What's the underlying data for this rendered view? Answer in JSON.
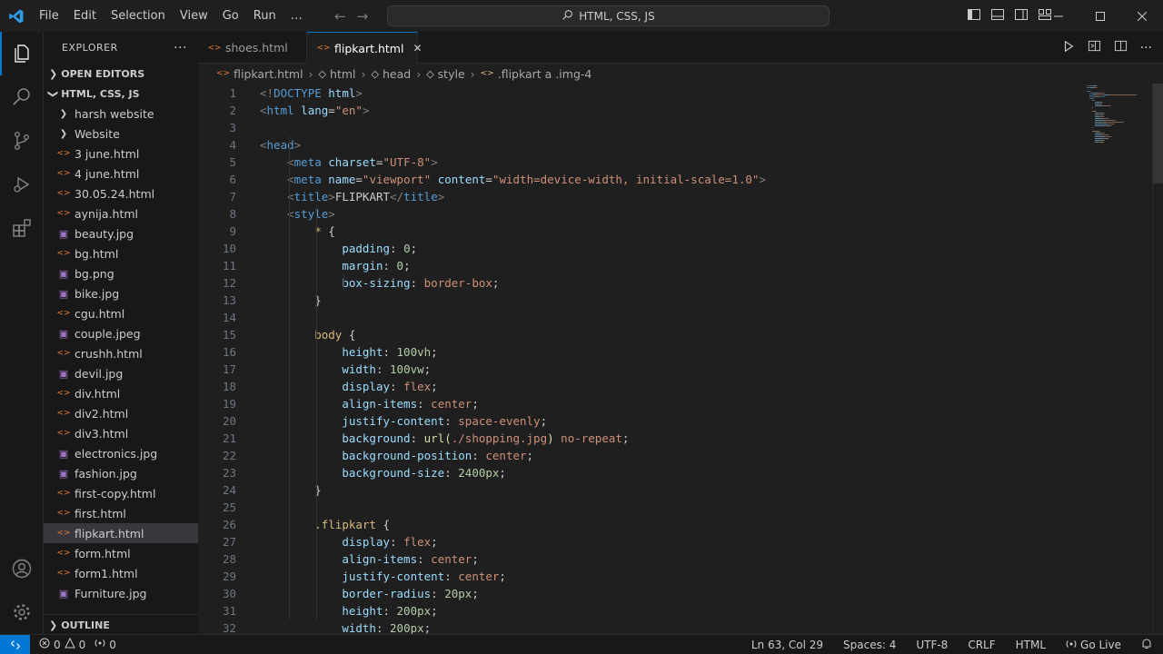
{
  "titlebar": {
    "menu": [
      "File",
      "Edit",
      "Selection",
      "View",
      "Go",
      "Run",
      "…"
    ],
    "command_center": "HTML, CSS, JS"
  },
  "sidebar": {
    "title": "EXPLORER",
    "open_editors": "OPEN EDITORS",
    "workspace": "HTML, CSS, JS",
    "items": [
      {
        "label": "harsh website",
        "kind": "folder"
      },
      {
        "label": "Website",
        "kind": "folder"
      },
      {
        "label": "3 june.html",
        "kind": "html"
      },
      {
        "label": "4 june.html",
        "kind": "html"
      },
      {
        "label": "30.05.24.html",
        "kind": "html"
      },
      {
        "label": "aynija.html",
        "kind": "html"
      },
      {
        "label": "beauty.jpg",
        "kind": "img"
      },
      {
        "label": "bg.html",
        "kind": "html"
      },
      {
        "label": "bg.png",
        "kind": "img"
      },
      {
        "label": "bike.jpg",
        "kind": "img"
      },
      {
        "label": "cgu.html",
        "kind": "html"
      },
      {
        "label": "couple.jpeg",
        "kind": "img"
      },
      {
        "label": "crushh.html",
        "kind": "html"
      },
      {
        "label": "devil.jpg",
        "kind": "img"
      },
      {
        "label": "div.html",
        "kind": "html"
      },
      {
        "label": "div2.html",
        "kind": "html"
      },
      {
        "label": "div3.html",
        "kind": "html"
      },
      {
        "label": "electronics.jpg",
        "kind": "img"
      },
      {
        "label": "fashion.jpg",
        "kind": "img"
      },
      {
        "label": "first-copy.html",
        "kind": "html"
      },
      {
        "label": "first.html",
        "kind": "html"
      },
      {
        "label": "flipkart.html",
        "kind": "html",
        "selected": true
      },
      {
        "label": "form.html",
        "kind": "html"
      },
      {
        "label": "form1.html",
        "kind": "html"
      },
      {
        "label": "Furniture.jpg",
        "kind": "img"
      }
    ],
    "outline": "OUTLINE"
  },
  "tabs": [
    {
      "label": "shoes.html",
      "active": false
    },
    {
      "label": "flipkart.html",
      "active": true
    }
  ],
  "breadcrumb": [
    "flipkart.html",
    "html",
    "head",
    "style",
    ".flipkart a .img-4"
  ],
  "code": [
    [
      [
        "<!",
        "punc"
      ],
      [
        "DOCTYPE",
        "tag"
      ],
      [
        " html",
        "attr"
      ],
      [
        ">",
        "punc"
      ]
    ],
    [
      [
        "<",
        "punc"
      ],
      [
        "html",
        "tag"
      ],
      [
        " lang",
        "attr"
      ],
      [
        "=",
        "plain"
      ],
      [
        "\"en\"",
        "str"
      ],
      [
        ">",
        "punc"
      ]
    ],
    [],
    [
      [
        "<",
        "punc"
      ],
      [
        "head",
        "tag"
      ],
      [
        ">",
        "punc"
      ]
    ],
    [
      [
        "    ",
        "plain"
      ],
      [
        "<",
        "punc"
      ],
      [
        "meta",
        "tag"
      ],
      [
        " charset",
        "attr"
      ],
      [
        "=",
        "plain"
      ],
      [
        "\"UTF-8\"",
        "str"
      ],
      [
        ">",
        "punc"
      ]
    ],
    [
      [
        "    ",
        "plain"
      ],
      [
        "<",
        "punc"
      ],
      [
        "meta",
        "tag"
      ],
      [
        " name",
        "attr"
      ],
      [
        "=",
        "plain"
      ],
      [
        "\"viewport\"",
        "str"
      ],
      [
        " content",
        "attr"
      ],
      [
        "=",
        "plain"
      ],
      [
        "\"width=device-width, initial-scale=1.0\"",
        "str"
      ],
      [
        ">",
        "punc"
      ]
    ],
    [
      [
        "    ",
        "plain"
      ],
      [
        "<",
        "punc"
      ],
      [
        "title",
        "tag"
      ],
      [
        ">",
        "punc"
      ],
      [
        "FLIPKART",
        "plain"
      ],
      [
        "</",
        "punc"
      ],
      [
        "title",
        "tag"
      ],
      [
        ">",
        "punc"
      ]
    ],
    [
      [
        "    ",
        "plain"
      ],
      [
        "<",
        "punc"
      ],
      [
        "style",
        "tag"
      ],
      [
        ">",
        "punc"
      ]
    ],
    [
      [
        "        ",
        "plain"
      ],
      [
        "* ",
        "sel"
      ],
      [
        "{",
        "plain"
      ]
    ],
    [
      [
        "            ",
        "plain"
      ],
      [
        "padding",
        "prop"
      ],
      [
        ": ",
        "plain"
      ],
      [
        "0",
        "num"
      ],
      [
        ";",
        "plain"
      ]
    ],
    [
      [
        "            ",
        "plain"
      ],
      [
        "margin",
        "prop"
      ],
      [
        ": ",
        "plain"
      ],
      [
        "0",
        "num"
      ],
      [
        ";",
        "plain"
      ]
    ],
    [
      [
        "            ",
        "plain"
      ],
      [
        "box-sizing",
        "prop"
      ],
      [
        ": ",
        "plain"
      ],
      [
        "border-box",
        "val"
      ],
      [
        ";",
        "plain"
      ]
    ],
    [
      [
        "        ",
        "plain"
      ],
      [
        "}",
        "plain"
      ]
    ],
    [],
    [
      [
        "        ",
        "plain"
      ],
      [
        "body ",
        "sel"
      ],
      [
        "{",
        "plain"
      ]
    ],
    [
      [
        "            ",
        "plain"
      ],
      [
        "height",
        "prop"
      ],
      [
        ": ",
        "plain"
      ],
      [
        "100vh",
        "num"
      ],
      [
        ";",
        "plain"
      ]
    ],
    [
      [
        "            ",
        "plain"
      ],
      [
        "width",
        "prop"
      ],
      [
        ": ",
        "plain"
      ],
      [
        "100vw",
        "num"
      ],
      [
        ";",
        "plain"
      ]
    ],
    [
      [
        "            ",
        "plain"
      ],
      [
        "display",
        "prop"
      ],
      [
        ": ",
        "plain"
      ],
      [
        "flex",
        "val"
      ],
      [
        ";",
        "plain"
      ]
    ],
    [
      [
        "            ",
        "plain"
      ],
      [
        "align-items",
        "prop"
      ],
      [
        ": ",
        "plain"
      ],
      [
        "center",
        "val"
      ],
      [
        ";",
        "plain"
      ]
    ],
    [
      [
        "            ",
        "plain"
      ],
      [
        "justify-content",
        "prop"
      ],
      [
        ": ",
        "plain"
      ],
      [
        "space-evenly",
        "val"
      ],
      [
        ";",
        "plain"
      ]
    ],
    [
      [
        "            ",
        "plain"
      ],
      [
        "background",
        "prop"
      ],
      [
        ": ",
        "plain"
      ],
      [
        "url(",
        "fn"
      ],
      [
        "./shopping.jpg",
        "str"
      ],
      [
        ")",
        "fn"
      ],
      [
        " no-repeat",
        "val"
      ],
      [
        ";",
        "plain"
      ]
    ],
    [
      [
        "            ",
        "plain"
      ],
      [
        "background-position",
        "prop"
      ],
      [
        ": ",
        "plain"
      ],
      [
        "center",
        "val"
      ],
      [
        ";",
        "plain"
      ]
    ],
    [
      [
        "            ",
        "plain"
      ],
      [
        "background-size",
        "prop"
      ],
      [
        ": ",
        "plain"
      ],
      [
        "2400px",
        "num"
      ],
      [
        ";",
        "plain"
      ]
    ],
    [
      [
        "        ",
        "plain"
      ],
      [
        "}",
        "plain"
      ]
    ],
    [],
    [
      [
        "        ",
        "plain"
      ],
      [
        ".flipkart ",
        "sel"
      ],
      [
        "{",
        "plain"
      ]
    ],
    [
      [
        "            ",
        "plain"
      ],
      [
        "display",
        "prop"
      ],
      [
        ": ",
        "plain"
      ],
      [
        "flex",
        "val"
      ],
      [
        ";",
        "plain"
      ]
    ],
    [
      [
        "            ",
        "plain"
      ],
      [
        "align-items",
        "prop"
      ],
      [
        ": ",
        "plain"
      ],
      [
        "center",
        "val"
      ],
      [
        ";",
        "plain"
      ]
    ],
    [
      [
        "            ",
        "plain"
      ],
      [
        "justify-content",
        "prop"
      ],
      [
        ": ",
        "plain"
      ],
      [
        "center",
        "val"
      ],
      [
        ";",
        "plain"
      ]
    ],
    [
      [
        "            ",
        "plain"
      ],
      [
        "border-radius",
        "prop"
      ],
      [
        ": ",
        "plain"
      ],
      [
        "20px",
        "num"
      ],
      [
        ";",
        "plain"
      ]
    ],
    [
      [
        "            ",
        "plain"
      ],
      [
        "height",
        "prop"
      ],
      [
        ": ",
        "plain"
      ],
      [
        "200px",
        "num"
      ],
      [
        ";",
        "plain"
      ]
    ],
    [
      [
        "            ",
        "plain"
      ],
      [
        "width",
        "prop"
      ],
      [
        ": ",
        "plain"
      ],
      [
        "200px",
        "num"
      ],
      [
        ";",
        "plain"
      ]
    ]
  ],
  "statusbar": {
    "errors": "0",
    "warnings": "0",
    "ports": "0",
    "position": "Ln 63, Col 29",
    "spaces": "Spaces: 4",
    "encoding": "UTF-8",
    "eol": "CRLF",
    "language": "HTML",
    "golive": "Go Live"
  },
  "colors": {
    "accent": "#0078d4",
    "html_icon": "#e37933",
    "img_icon": "#a074c4"
  }
}
